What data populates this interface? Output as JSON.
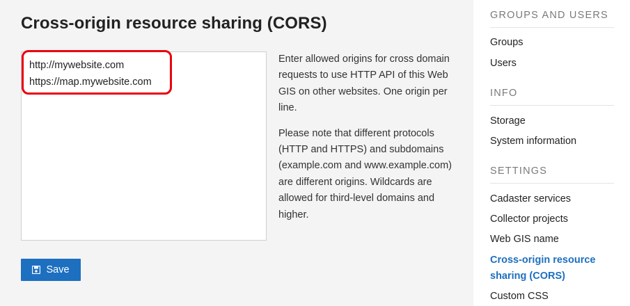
{
  "main": {
    "title": "Cross-origin resource sharing (CORS)",
    "origins": [
      "http://mywebsite.com",
      "https://map.mywebsite.com"
    ],
    "help": [
      "Enter allowed origins for cross domain requests to use HTTP API of this Web GIS on other websites. One origin per line.",
      "Please note that different protocols (HTTP and HTTPS) and subdomains (example.com and www.example.com) are different origins. Wildcards are allowed for third-level domains and higher."
    ],
    "save_label": "Save",
    "save_icon": "floppy-disk-icon"
  },
  "sidebar": {
    "sections": [
      {
        "heading": "GROUPS AND USERS",
        "items": [
          "Groups",
          "Users"
        ]
      },
      {
        "heading": "INFO",
        "items": [
          "Storage",
          "System information"
        ]
      },
      {
        "heading": "SETTINGS",
        "items": [
          "Cadaster services",
          "Collector projects",
          "Web GIS name",
          "Cross-origin resource sharing (CORS)",
          "Custom CSS"
        ]
      }
    ],
    "active_item": "Cross-origin resource sharing (CORS)"
  },
  "colors": {
    "accent": "#1d6fc0",
    "highlight": "#e8000f"
  }
}
